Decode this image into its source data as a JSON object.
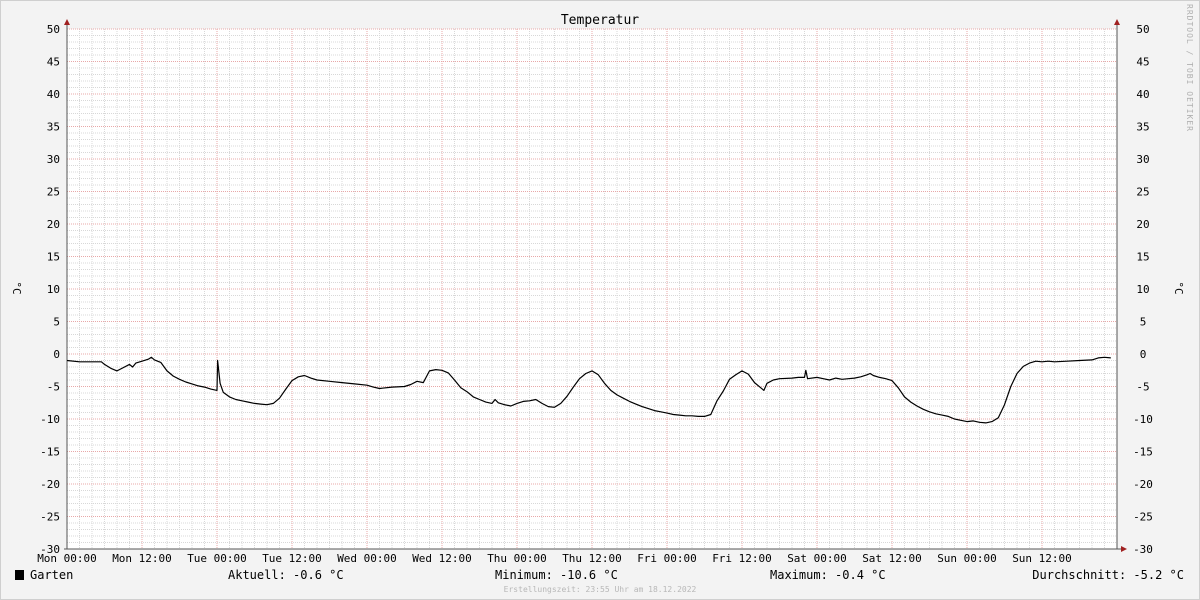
{
  "chart_data": {
    "type": "line",
    "title": "Temperatur",
    "ylabel": "°C",
    "ylim": [
      -30,
      50
    ],
    "y_ticks": [
      50,
      45,
      40,
      35,
      30,
      25,
      20,
      15,
      10,
      5,
      0,
      -5,
      -10,
      -15,
      -20,
      -25,
      -30
    ],
    "x_range_hours": [
      0,
      168
    ],
    "x_ticks": [
      {
        "hour": 0,
        "label": "Mon 00:00"
      },
      {
        "hour": 12,
        "label": "Mon 12:00"
      },
      {
        "hour": 24,
        "label": "Tue 00:00"
      },
      {
        "hour": 36,
        "label": "Tue 12:00"
      },
      {
        "hour": 48,
        "label": "Wed 00:00"
      },
      {
        "hour": 60,
        "label": "Wed 12:00"
      },
      {
        "hour": 72,
        "label": "Thu 00:00"
      },
      {
        "hour": 84,
        "label": "Thu 12:00"
      },
      {
        "hour": 96,
        "label": "Fri 00:00"
      },
      {
        "hour": 108,
        "label": "Fri 12:00"
      },
      {
        "hour": 120,
        "label": "Sat 00:00"
      },
      {
        "hour": 132,
        "label": "Sat 12:00"
      },
      {
        "hour": 144,
        "label": "Sun 00:00"
      },
      {
        "hour": 156,
        "label": "Sun 12:00"
      }
    ],
    "grid": true,
    "series": [
      {
        "name": "Garten",
        "color": "#000000",
        "points": [
          [
            0,
            -1.0
          ],
          [
            2,
            -1.2
          ],
          [
            4,
            -1.2
          ],
          [
            5.5,
            -1.2
          ],
          [
            6,
            -1.6
          ],
          [
            7,
            -2.2
          ],
          [
            8,
            -2.6
          ],
          [
            9,
            -2.1
          ],
          [
            10,
            -1.6
          ],
          [
            10.5,
            -2.0
          ],
          [
            11,
            -1.4
          ],
          [
            12,
            -1.1
          ],
          [
            13,
            -0.8
          ],
          [
            13.5,
            -0.5
          ],
          [
            14,
            -0.9
          ],
          [
            15,
            -1.3
          ],
          [
            16,
            -2.6
          ],
          [
            17,
            -3.4
          ],
          [
            18,
            -3.9
          ],
          [
            19,
            -4.3
          ],
          [
            20,
            -4.6
          ],
          [
            21,
            -4.9
          ],
          [
            22,
            -5.1
          ],
          [
            23,
            -5.4
          ],
          [
            24,
            -5.6
          ],
          [
            24.1,
            -1.0
          ],
          [
            24.5,
            -4.5
          ],
          [
            25,
            -5.9
          ],
          [
            26,
            -6.6
          ],
          [
            27,
            -7.0
          ],
          [
            28,
            -7.2
          ],
          [
            29,
            -7.4
          ],
          [
            30,
            -7.6
          ],
          [
            31,
            -7.7
          ],
          [
            32,
            -7.8
          ],
          [
            33,
            -7.6
          ],
          [
            34,
            -6.8
          ],
          [
            35,
            -5.4
          ],
          [
            36,
            -4.1
          ],
          [
            37,
            -3.5
          ],
          [
            38,
            -3.3
          ],
          [
            39,
            -3.7
          ],
          [
            40,
            -4.0
          ],
          [
            42,
            -4.2
          ],
          [
            44,
            -4.4
          ],
          [
            46,
            -4.6
          ],
          [
            48,
            -4.8
          ],
          [
            49,
            -5.1
          ],
          [
            50,
            -5.3
          ],
          [
            52,
            -5.1
          ],
          [
            54,
            -5.0
          ],
          [
            55,
            -4.7
          ],
          [
            56,
            -4.2
          ],
          [
            57,
            -4.4
          ],
          [
            58,
            -2.6
          ],
          [
            59,
            -2.4
          ],
          [
            60,
            -2.5
          ],
          [
            61,
            -2.9
          ],
          [
            62,
            -4.0
          ],
          [
            63,
            -5.2
          ],
          [
            64,
            -5.8
          ],
          [
            65,
            -6.6
          ],
          [
            66,
            -7.0
          ],
          [
            67,
            -7.4
          ],
          [
            68,
            -7.6
          ],
          [
            68.5,
            -7.0
          ],
          [
            69,
            -7.5
          ],
          [
            70,
            -7.8
          ],
          [
            71,
            -8.0
          ],
          [
            72,
            -7.6
          ],
          [
            73,
            -7.3
          ],
          [
            74,
            -7.2
          ],
          [
            75,
            -7.0
          ],
          [
            76,
            -7.6
          ],
          [
            77,
            -8.1
          ],
          [
            78,
            -8.2
          ],
          [
            79,
            -7.6
          ],
          [
            80,
            -6.5
          ],
          [
            81,
            -5.1
          ],
          [
            82,
            -3.8
          ],
          [
            83,
            -3.0
          ],
          [
            84,
            -2.6
          ],
          [
            85,
            -3.2
          ],
          [
            86,
            -4.5
          ],
          [
            87,
            -5.6
          ],
          [
            88,
            -6.3
          ],
          [
            89,
            -6.8
          ],
          [
            90,
            -7.3
          ],
          [
            91,
            -7.7
          ],
          [
            92,
            -8.1
          ],
          [
            93,
            -8.4
          ],
          [
            94,
            -8.7
          ],
          [
            95,
            -8.9
          ],
          [
            96,
            -9.1
          ],
          [
            97,
            -9.3
          ],
          [
            98,
            -9.4
          ],
          [
            99,
            -9.5
          ],
          [
            100,
            -9.5
          ],
          [
            101,
            -9.6
          ],
          [
            102,
            -9.6
          ],
          [
            103,
            -9.3
          ],
          [
            104,
            -7.2
          ],
          [
            105,
            -5.7
          ],
          [
            106,
            -3.9
          ],
          [
            107,
            -3.2
          ],
          [
            108,
            -2.6
          ],
          [
            109,
            -3.1
          ],
          [
            110,
            -4.4
          ],
          [
            111,
            -5.2
          ],
          [
            111.5,
            -5.6
          ],
          [
            112,
            -4.5
          ],
          [
            113,
            -4.0
          ],
          [
            114,
            -3.8
          ],
          [
            116,
            -3.7
          ],
          [
            117,
            -3.6
          ],
          [
            118,
            -3.6
          ],
          [
            118.2,
            -2.5
          ],
          [
            118.5,
            -3.8
          ],
          [
            120,
            -3.6
          ],
          [
            121,
            -3.8
          ],
          [
            122,
            -4.0
          ],
          [
            123,
            -3.7
          ],
          [
            124,
            -3.9
          ],
          [
            125,
            -3.8
          ],
          [
            126,
            -3.7
          ],
          [
            127,
            -3.5
          ],
          [
            128,
            -3.2
          ],
          [
            128.5,
            -3.0
          ],
          [
            129,
            -3.3
          ],
          [
            130,
            -3.6
          ],
          [
            131,
            -3.8
          ],
          [
            132,
            -4.1
          ],
          [
            133,
            -5.2
          ],
          [
            134,
            -6.6
          ],
          [
            135,
            -7.4
          ],
          [
            136,
            -8.0
          ],
          [
            137,
            -8.5
          ],
          [
            138,
            -8.9
          ],
          [
            139,
            -9.2
          ],
          [
            140,
            -9.4
          ],
          [
            141,
            -9.6
          ],
          [
            142,
            -10.0
          ],
          [
            143,
            -10.2
          ],
          [
            144,
            -10.4
          ],
          [
            145,
            -10.3
          ],
          [
            146,
            -10.5
          ],
          [
            147,
            -10.6
          ],
          [
            148,
            -10.4
          ],
          [
            149,
            -9.8
          ],
          [
            150,
            -7.8
          ],
          [
            151,
            -5.0
          ],
          [
            152,
            -3.0
          ],
          [
            153,
            -1.9
          ],
          [
            154,
            -1.4
          ],
          [
            155,
            -1.1
          ],
          [
            156,
            -1.2
          ],
          [
            157,
            -1.1
          ],
          [
            158,
            -1.2
          ],
          [
            160,
            -1.1
          ],
          [
            162,
            -1.0
          ],
          [
            164,
            -0.9
          ],
          [
            165,
            -0.6
          ],
          [
            166,
            -0.5
          ],
          [
            167,
            -0.6
          ]
        ]
      }
    ],
    "legend": {
      "series_name": "Garten",
      "swatch_color": "#000000",
      "current": "Aktuell: -0.6 °C",
      "minimum": "Minimum: -10.6 °C",
      "maximum": "Maximum: -0.4 °C",
      "average": "Durchschnitt: -5.2 °C"
    },
    "watermark": "RRDTOOL / TOBI OETIKER",
    "footer": "Erstellungszeit: 23:55 Uhr am 18.12.2022"
  },
  "colors": {
    "background": "#f3f3f3",
    "plot_area": "#ffffff",
    "major_grid": "#e8a8a8",
    "minor_grid": "#d8d8d8",
    "axis": "#555555",
    "arrow": "#a02020"
  }
}
